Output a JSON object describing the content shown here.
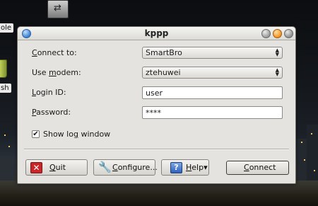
{
  "window": {
    "title": "kppp"
  },
  "desktop": {
    "icon_left_top_label": "ole",
    "icon_left_trash_label": "sh"
  },
  "form": {
    "connect_to": {
      "label_pre": "",
      "label_ul": "C",
      "label_post": "onnect to:",
      "value": "SmartBro"
    },
    "use_modem": {
      "label_pre": "Use ",
      "label_ul": "m",
      "label_post": "odem:",
      "value": "ztehuwei"
    },
    "login_id": {
      "label_pre": "",
      "label_ul": "L",
      "label_post": "ogin ID:",
      "value": "user"
    },
    "password": {
      "label_pre": "",
      "label_ul": "P",
      "label_post": "assword:",
      "value": "****"
    },
    "show_log": {
      "label_pre": "Show lo",
      "label_ul": "g",
      "label_post": " window",
      "checked": true,
      "check_glyph": "✔"
    }
  },
  "buttons": {
    "quit": {
      "ul": "Q",
      "rest": "uit"
    },
    "configure": {
      "ul": "C",
      "rest": "onfigure..."
    },
    "help": {
      "ul": "H",
      "rest": "elp",
      "arrow": "▾"
    },
    "connect": {
      "ul": "C",
      "rest": "onnect"
    }
  },
  "icons": {
    "quit": "close-x-icon",
    "configure": "wrench-icon",
    "help": "help-book-icon"
  }
}
